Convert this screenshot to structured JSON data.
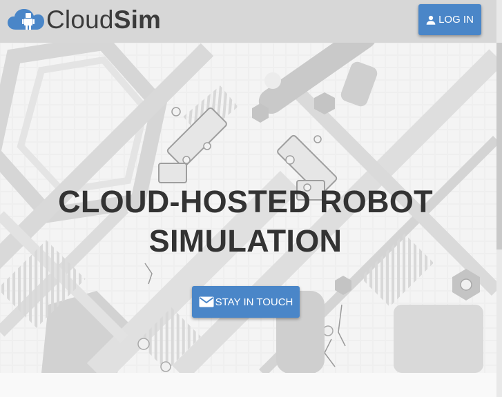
{
  "header": {
    "logo": {
      "light_text": "Cloud",
      "bold_text": "Sim"
    },
    "login_label": "LOG IN"
  },
  "hero": {
    "title_line1": "CLOUD-HOSTED ROBOT",
    "title_line2": "SIMULATION",
    "cta_label": "STAY IN TOUCH"
  },
  "colors": {
    "accent": "#4a86c8",
    "header_bg": "#d7d7d7",
    "title_text": "#333333"
  },
  "icons": [
    "cloud-robot-logo",
    "person-icon",
    "mail-icon"
  ]
}
